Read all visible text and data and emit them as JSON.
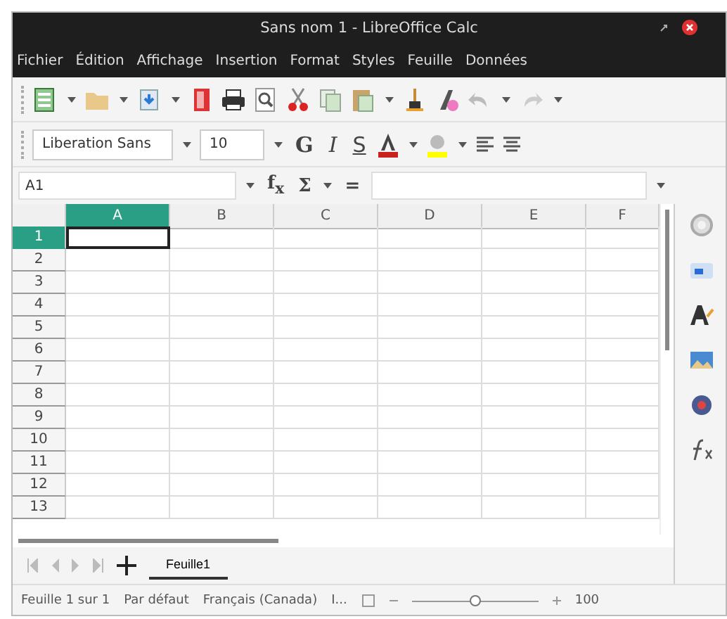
{
  "window": {
    "title": "Sans nom 1 - LibreOffice Calc"
  },
  "menu": [
    "Fichier",
    "Édition",
    "Affichage",
    "Insertion",
    "Format",
    "Styles",
    "Feuille",
    "Données"
  ],
  "standard_toolbar": [
    {
      "kind": "new",
      "dropdown": true
    },
    {
      "kind": "open",
      "dropdown": true
    },
    {
      "kind": "save",
      "dropdown": true
    },
    {
      "kind": "pdf",
      "dropdown": false
    },
    {
      "kind": "print",
      "dropdown": false
    },
    {
      "kind": "preview",
      "dropdown": false
    },
    {
      "kind": "cut",
      "dropdown": false
    },
    {
      "kind": "copy",
      "dropdown": false
    },
    {
      "kind": "paste",
      "dropdown": true
    },
    {
      "kind": "brush",
      "dropdown": false
    },
    {
      "kind": "clear",
      "dropdown": false
    },
    {
      "kind": "undo",
      "dropdown": true
    },
    {
      "kind": "redo",
      "dropdown": true
    }
  ],
  "format_toolbar": {
    "font": "Liberation Sans",
    "size": "10",
    "styles": [
      {
        "label": "G",
        "kind": "bold"
      },
      {
        "label": "I",
        "kind": "italic"
      },
      {
        "label": "S",
        "kind": "underline"
      }
    ],
    "colors": [
      {
        "kind": "font-color",
        "color": "#c9211e"
      },
      {
        "kind": "highlight",
        "color": "#ffff00"
      }
    ]
  },
  "formula_bar": {
    "name_box": "A1",
    "buttons": [
      {
        "kind": "function",
        "label": "f$_{x}$"
      },
      {
        "kind": "sum",
        "label": "Σ"
      },
      {
        "kind": "equals",
        "label": "="
      }
    ]
  },
  "columns": [
    {
      "label": "A",
      "selected": true
    },
    {
      "label": "B",
      "selected": false
    },
    {
      "label": "C",
      "selected": false
    },
    {
      "label": "D",
      "selected": false
    },
    {
      "label": "E",
      "selected": false
    },
    {
      "label": "F",
      "selected": false
    }
  ],
  "rows": [
    {
      "label": "1",
      "selected": true
    },
    {
      "label": "2",
      "selected": false
    },
    {
      "label": "3",
      "selected": false
    },
    {
      "label": "4",
      "selected": false
    },
    {
      "label": "5",
      "selected": false
    },
    {
      "label": "6",
      "selected": false
    },
    {
      "label": "7",
      "selected": false
    },
    {
      "label": "8",
      "selected": false
    },
    {
      "label": "9",
      "selected": false
    },
    {
      "label": "10",
      "selected": false
    },
    {
      "label": "11",
      "selected": false
    },
    {
      "label": "12",
      "selected": false
    },
    {
      "label": "13",
      "selected": false
    }
  ],
  "sheet_tabs": [
    {
      "label": "Feuille1",
      "selected": true
    }
  ],
  "sidebar": [
    {
      "kind": "settings"
    },
    {
      "kind": "properties"
    },
    {
      "kind": "styles"
    },
    {
      "kind": "gallery"
    },
    {
      "kind": "navigator"
    },
    {
      "kind": "functions"
    }
  ],
  "status_bar": {
    "sheet": "Feuille 1 sur 1",
    "page_style": "Par défaut",
    "language": "Français (Canada)",
    "selection_mode": "I...",
    "zoom": {
      "level": 0.5,
      "reading": "100"
    }
  }
}
